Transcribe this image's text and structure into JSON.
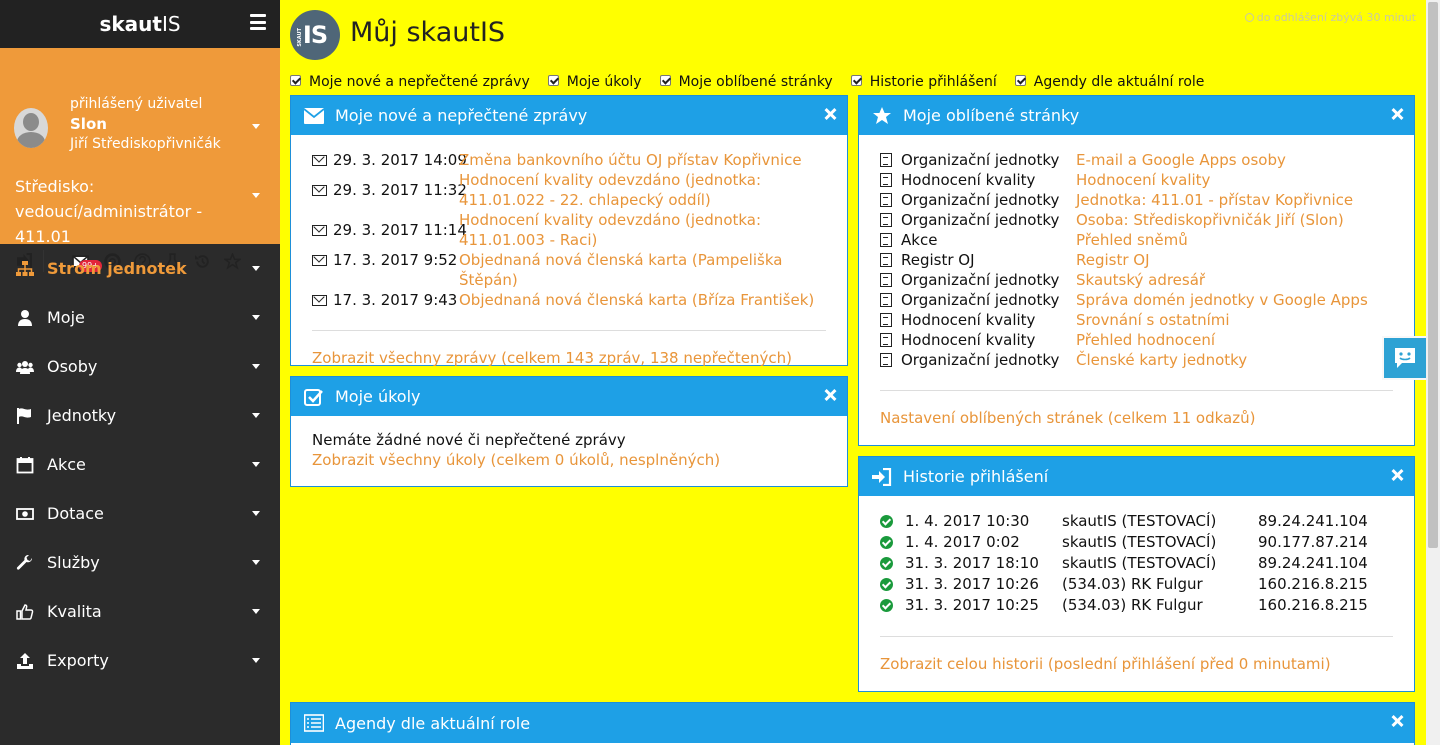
{
  "sidebar": {
    "brand": {
      "bold": "skaut",
      "light": "IS"
    },
    "user": {
      "label": "přihlášený uživatel",
      "nick": "Slon",
      "name": "Jiří Střediskopřivničák"
    },
    "unit_role": "Středisko: vedoucí/administrátor - 411.01",
    "notification_badge": "99+",
    "nav": [
      {
        "label": "Strom jednotek",
        "icon": "sitemap-icon"
      },
      {
        "label": "Moje",
        "icon": "user-icon"
      },
      {
        "label": "Osoby",
        "icon": "users-icon"
      },
      {
        "label": "Jednotky",
        "icon": "flag-icon"
      },
      {
        "label": "Akce",
        "icon": "calendar-icon"
      },
      {
        "label": "Dotace",
        "icon": "money-icon"
      },
      {
        "label": "Služby",
        "icon": "wrench-icon"
      },
      {
        "label": "Kvalita",
        "icon": "thumbs-up-icon"
      },
      {
        "label": "Exporty",
        "icon": "upload-icon"
      }
    ]
  },
  "header": {
    "logo": "IS",
    "logo_small": "SKAUT",
    "title": "Můj skautIS",
    "session": "do odhlášení zbývá 30 minut"
  },
  "toggles": [
    "Moje nové a nepřečtené zprávy",
    "Moje úkoly",
    "Moje oblíbené stránky",
    "Historie přihlášení",
    "Agendy dle aktuální role"
  ],
  "messages": {
    "title": "Moje nové a nepřečtené zprávy",
    "rows": [
      {
        "date": "29. 3. 2017 14:09",
        "text": "Změna bankovního účtu OJ přístav Kopřivnice"
      },
      {
        "date": "29. 3. 2017 11:32",
        "text": "Hodnocení kvality odevzdáno (jednotka: 411.01.022 - 22. chlapecký oddíl)"
      },
      {
        "date": "29. 3. 2017 11:14",
        "text": "Hodnocení kvality odevzdáno (jednotka: 411.01.003 - Raci)"
      },
      {
        "date": "17. 3. 2017 9:52",
        "text": "Objednaná nová členská karta (Pampeliška Štěpán)"
      },
      {
        "date": "17. 3. 2017 9:43",
        "text": "Objednaná nová členská karta (Bříza František)"
      }
    ],
    "footer": "Zobrazit všechny zprávy (celkem 143 zpráv, 138 nepřečtených)"
  },
  "tasks": {
    "title": "Moje úkoly",
    "empty": "Nemáte žádné nové či nepřečtené zprávy",
    "footer": "Zobrazit všechny úkoly (celkem 0 úkolů, nesplněných)"
  },
  "favorites": {
    "title": "Moje oblíbené stránky",
    "rows": [
      {
        "cat": "Organizační jednotky",
        "link": "E-mail a Google Apps osoby"
      },
      {
        "cat": "Hodnocení kvality",
        "link": "Hodnocení kvality"
      },
      {
        "cat": "Organizační jednotky",
        "link": "Jednotka: 411.01 - přístav Kopřivnice"
      },
      {
        "cat": "Organizační jednotky",
        "link": "Osoba: Střediskopřivničák Jiří (Slon)"
      },
      {
        "cat": "Akce",
        "link": "Přehled sněmů"
      },
      {
        "cat": "Registr OJ",
        "link": "Registr OJ"
      },
      {
        "cat": "Organizační jednotky",
        "link": "Skautský adresář"
      },
      {
        "cat": "Organizační jednotky",
        "link": "Správa domén jednotky v Google Apps"
      },
      {
        "cat": "Hodnocení kvality",
        "link": "Srovnání s ostatními"
      },
      {
        "cat": "Hodnocení kvality",
        "link": "Přehled hodnocení"
      },
      {
        "cat": "Organizační jednotky",
        "link": "Členské karty jednotky"
      }
    ],
    "footer": "Nastavení oblíbených stránek (celkem 11 odkazů)"
  },
  "history": {
    "title": "Historie přihlášení",
    "rows": [
      {
        "date": "1. 4. 2017 10:30",
        "system": "skautIS (TESTOVACÍ)",
        "ip": "89.24.241.104"
      },
      {
        "date": "1. 4. 2017 0:02",
        "system": "skautIS (TESTOVACÍ)",
        "ip": "90.177.87.214"
      },
      {
        "date": "31. 3. 2017 18:10",
        "system": "skautIS (TESTOVACÍ)",
        "ip": "89.24.241.104"
      },
      {
        "date": "31. 3. 2017 10:26",
        "system": "(534.03) RK Fulgur",
        "ip": "160.216.8.215"
      },
      {
        "date": "31. 3. 2017 10:25",
        "system": "(534.03) RK Fulgur",
        "ip": "160.216.8.215"
      }
    ],
    "footer": "Zobrazit celou historii (poslední přihlášení před 0 minutami)"
  },
  "agendas": {
    "title": "Agendy dle aktuální role"
  },
  "colors": {
    "background": "#ffff00",
    "sidebar": "#2b2b2b",
    "accent": "#ef9a3a",
    "panel_header": "#1ea0e6",
    "link": "#e8953a",
    "success": "#1a9a3c"
  }
}
